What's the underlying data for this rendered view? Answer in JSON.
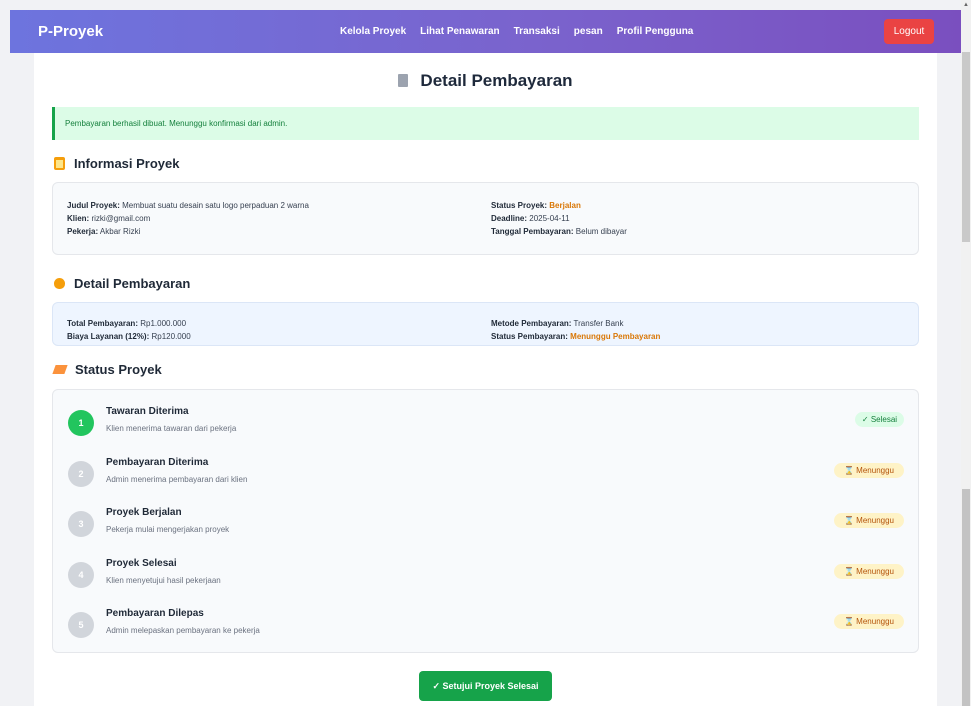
{
  "navbar": {
    "brand": "P-Proyek",
    "links": [
      "Kelola Proyek",
      "Lihat Penawaran",
      "Transaksi",
      "pesan",
      "Profil Pengguna"
    ],
    "logout_label": "Logout"
  },
  "page": {
    "title": "Detail Pembayaran",
    "alert": "Pembayaran berhasil dibuat. Menunggu konfirmasi dari admin."
  },
  "project_info": {
    "heading": "Informasi Proyek",
    "judul_label": "Judul Proyek:",
    "judul_value": "Membuat suatu desain satu logo perpaduan 2 warna",
    "klien_label": "Klien:",
    "klien_value": "rizki@gmail.com",
    "pekerja_label": "Pekerja:",
    "pekerja_value": "Akbar Rizki",
    "status_label": "Status Proyek:",
    "status_value": "Berjalan",
    "deadline_label": "Deadline:",
    "deadline_value": "2025-04-11",
    "tanggal_label": "Tanggal Pembayaran:",
    "tanggal_value": "Belum dibayar"
  },
  "payment_detail": {
    "heading": "Detail Pembayaran",
    "total_label": "Total Pembayaran:",
    "total_value": "Rp1.000.000",
    "biaya_label": "Biaya Layanan (12%):",
    "biaya_value": "Rp120.000",
    "metode_label": "Metode Pembayaran:",
    "metode_value": "Transfer Bank",
    "status_label": "Status Pembayaran:",
    "status_value": "Menunggu Pembayaran"
  },
  "project_status": {
    "heading": "Status Proyek",
    "steps": [
      {
        "num": "1",
        "title": "Tawaran Diterima",
        "desc": "Klien menerima tawaran dari pekerja",
        "badge": "✓ Selesai"
      },
      {
        "num": "2",
        "title": "Pembayaran Diterima",
        "desc": "Admin menerima pembayaran dari klien",
        "badge": "⌛ Menunggu"
      },
      {
        "num": "3",
        "title": "Proyek Berjalan",
        "desc": "Pekerja mulai mengerjakan proyek",
        "badge": "⌛ Menunggu"
      },
      {
        "num": "4",
        "title": "Proyek Selesai",
        "desc": "Klien menyetujui hasil pekerjaan",
        "badge": "⌛ Menunggu"
      },
      {
        "num": "5",
        "title": "Pembayaran Dilepas",
        "desc": "Admin melepaskan pembayaran ke pekerja",
        "badge": "⌛ Menunggu"
      }
    ]
  },
  "actions": {
    "approve_label": "✓ Setujui Proyek Selesai"
  }
}
